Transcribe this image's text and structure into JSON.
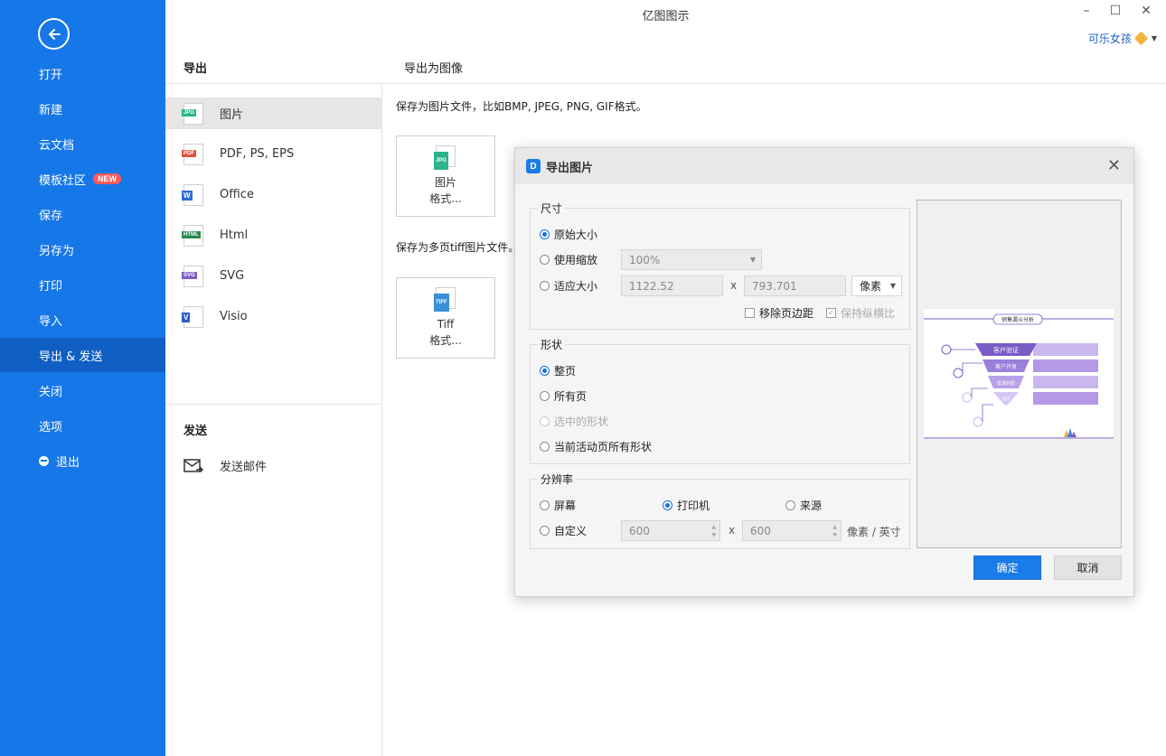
{
  "app": {
    "title": "亿图图示",
    "user": "可乐女孩"
  },
  "sidebar": {
    "items": [
      {
        "label": "打开"
      },
      {
        "label": "新建"
      },
      {
        "label": "云文档"
      },
      {
        "label": "模板社区",
        "badge": "NEW"
      },
      {
        "label": "保存"
      },
      {
        "label": "另存为"
      },
      {
        "label": "打印"
      },
      {
        "label": "导入"
      },
      {
        "label": "导出 & 发送",
        "active": true
      },
      {
        "label": "关闭"
      },
      {
        "label": "选项"
      },
      {
        "label": "退出"
      }
    ]
  },
  "export_panel": {
    "heading": "导出",
    "formats": [
      {
        "label": "图片",
        "icon": "jpg-file-icon",
        "tag": "JPG",
        "color": "#2bb48c"
      },
      {
        "label": "PDF, PS, EPS",
        "icon": "pdf-file-icon",
        "tag": "PDF",
        "color": "#e0533d"
      },
      {
        "label": "Office",
        "icon": "word-file-icon",
        "tag": "W",
        "color": "#2f6fd6"
      },
      {
        "label": "Html",
        "icon": "html-file-icon",
        "tag": "HTML",
        "color": "#2a8a4a"
      },
      {
        "label": "SVG",
        "icon": "svg-file-icon",
        "tag": "SVG",
        "color": "#7a5cc8"
      },
      {
        "label": "Visio",
        "icon": "visio-file-icon",
        "tag": "V",
        "color": "#2f5fbf"
      }
    ],
    "send_heading": "发送",
    "send_email": "发送邮件"
  },
  "content": {
    "heading": "导出为图像",
    "desc_image": "保存为图片文件，比如BMP, JPEG, PNG, GIF格式。",
    "btn_image": [
      "图片",
      "格式..."
    ],
    "desc_tiff": "保存为多页tiff图片文件。",
    "btn_tiff": [
      "Tiff",
      "格式..."
    ]
  },
  "dialog": {
    "title": "导出图片",
    "size": {
      "title": "尺寸",
      "original": "原始大小",
      "scale": "使用缩放",
      "scale_value": "100%",
      "fit": "适应大小",
      "width": "1122.52",
      "height": "793.701",
      "x": "x",
      "unit": "像素",
      "remove_margin": "移除页边距",
      "keep_ratio": "保持纵横比",
      "selected": "original"
    },
    "shape": {
      "title": "形状",
      "whole_page": "整页",
      "all_pages": "所有页",
      "selected_shapes": "选中的形状",
      "active_page_shapes": "当前活动页所有形状",
      "selected": "whole_page"
    },
    "resolution": {
      "title": "分辨率",
      "screen": "屏幕",
      "printer": "打印机",
      "source": "来源",
      "custom": "自定义",
      "x_value": "600",
      "y_value": "600",
      "x": "x",
      "unit": "像素 / 英寸",
      "selected": "printer"
    },
    "preview": {
      "title": "销售漏斗分析",
      "stages": [
        "客户验证",
        "客户开发",
        "需求匹配",
        "签约"
      ]
    },
    "ok": "确定",
    "cancel": "取消"
  },
  "colors": {
    "accent": "#1677e8",
    "sidebar_active": "#0f5fc4",
    "funnel": "#8d6bd6"
  }
}
